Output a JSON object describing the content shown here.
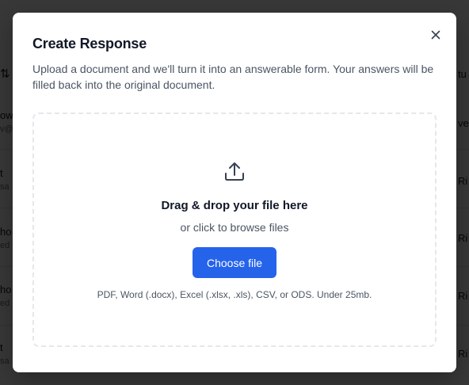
{
  "background": {
    "left_items": [
      {
        "text": "ow",
        "sub": "v@"
      },
      {
        "text": "t",
        "sub": "sa"
      },
      {
        "text": "ho",
        "sub": "ed"
      },
      {
        "text": "ho",
        "sub": "ed"
      },
      {
        "text": "t",
        "sub": "sa"
      }
    ],
    "right_items": [
      "tu",
      "ve",
      "Ri",
      "Ri",
      "Ri",
      "Ri"
    ]
  },
  "modal": {
    "title": "Create Response",
    "close_icon": "close-icon",
    "description": "Upload a document and we'll turn it into an answerable form. Your answers will be filled back into the original document.",
    "dropzone": {
      "icon": "upload-icon",
      "title": "Drag & drop your file here",
      "subtitle": "or click to browse files",
      "button_label": "Choose file",
      "formats": "PDF, Word (.docx), Excel (.xlsx, .xls), CSV, or ODS. Under 25mb."
    }
  },
  "colors": {
    "accent": "#2563eb",
    "overlay": "rgba(0,0,0,0.78)",
    "title": "#111827",
    "text_muted": "#4b5563",
    "dropzone_border": "#e5e7eb"
  }
}
